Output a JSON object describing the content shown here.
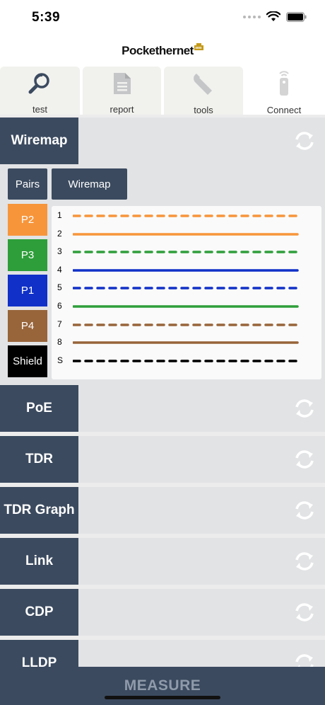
{
  "status_bar": {
    "time": "5:39"
  },
  "app": {
    "logo_text": "Pockethernet"
  },
  "tabs": [
    {
      "label": "test",
      "icon": "search-magnify-icon"
    },
    {
      "label": "report",
      "icon": "document-icon"
    },
    {
      "label": "tools",
      "icon": "wrench-icon"
    },
    {
      "label": "Connect",
      "icon": "remote-device-icon"
    }
  ],
  "wiremap": {
    "title": "Wiremap",
    "buttons": {
      "pairs": "Pairs",
      "wiremap": "Wiremap"
    },
    "pairs": [
      {
        "label": "P2",
        "color": "#f7953b"
      },
      {
        "label": "P3",
        "color": "#2e9e3a"
      },
      {
        "label": "P1",
        "color": "#1030c8"
      },
      {
        "label": "P4",
        "color": "#98643a"
      },
      {
        "label": "Shield",
        "color": "#000000"
      }
    ],
    "wires": [
      {
        "num": "1",
        "color": "#f7953b",
        "style": "dashed"
      },
      {
        "num": "2",
        "color": "#f7953b",
        "style": "solid"
      },
      {
        "num": "3",
        "color": "#2e9e3a",
        "style": "dashed"
      },
      {
        "num": "4",
        "color": "#1030c8",
        "style": "solid"
      },
      {
        "num": "5",
        "color": "#1030c8",
        "style": "dashed"
      },
      {
        "num": "6",
        "color": "#2e9e3a",
        "style": "solid"
      },
      {
        "num": "7",
        "color": "#98643a",
        "style": "dashed"
      },
      {
        "num": "8",
        "color": "#98643a",
        "style": "solid"
      },
      {
        "num": "S",
        "color": "#000000",
        "style": "dashed"
      }
    ]
  },
  "sections": [
    {
      "title": "PoE"
    },
    {
      "title": "TDR"
    },
    {
      "title": "TDR Graph"
    },
    {
      "title": "Link"
    },
    {
      "title": "CDP"
    },
    {
      "title": "LLDP"
    }
  ],
  "footer": {
    "measure_label": "MEASURE"
  },
  "colors": {
    "header_navy": "#3b4a5f",
    "panel_gray": "#e2e3e5"
  }
}
